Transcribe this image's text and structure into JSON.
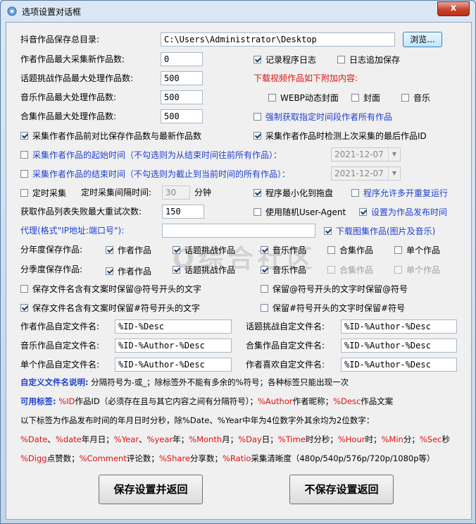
{
  "window": {
    "title": "选项设置对话框",
    "close_label": "x"
  },
  "main": {
    "save_dir_label": "抖音作品保存总目录:",
    "save_dir_value": "C:\\Users\\Administrator\\Desktop",
    "browse_label": "浏览...",
    "author_max_label": "作者作品最大采集新作品数:",
    "author_max_value": "0",
    "topic_max_label": "话题挑战作品最大处理作品数:",
    "topic_max_value": "500",
    "music_max_label": "音乐作品最大处理作品数:",
    "music_max_value": "500",
    "collection_max_label": "合集作品最大处理作品数:",
    "collection_max_value": "500",
    "log_label": "记录程序日志",
    "log_append_label": "日志追加保存",
    "download_extra_label": "下载视频作品如下附加内容:",
    "webp_label": "WEBP动态封面",
    "cover_label": "封面",
    "music_label": "音乐",
    "force_time_label": "强制获取指定时间段作者所有作品",
    "compare_label": "采集作者作品前对比保存作品数与最新作品数",
    "detect_last_label": "采集作者作品时检测上次采集的最后作品ID",
    "start_time_label": "采集作者作品的起始时间（不勾选则为从结束时间往前所有作品）：",
    "start_date": "2021-12-07",
    "end_time_label": "采集作者作品的结束时间（不勾选则为截止到当前时间的所有作品）：",
    "end_date": "2021-12-07",
    "timer_label": "定时采集",
    "timer_interval_label": "定时采集间隔时间:",
    "timer_value": "30",
    "timer_unit": "分钟",
    "min_tray_label": "程序最小化到拖盘",
    "multi_label": "程序允许多开重复运行",
    "retry_label": "获取作品列表失败最大重试次数:",
    "retry_value": "150",
    "random_ua_label": "使用随机User-Agent",
    "set_time_label": "设置为作品发布时间",
    "proxy_label": "代理(格式\"IP地址:端口号\"):",
    "proxy_value": "",
    "download_album_label": "下载图集作品(图片及音乐)",
    "year_save_label": "分年度保存作品:",
    "quarter_save_label": "分季度保存作品:",
    "author_works": "作者作品",
    "topic_works": "话题挑战作品",
    "music_works": "音乐作品",
    "collection_works": "合集作品",
    "single_works": "单个作品",
    "keep_at_label": "保存文件名含有文案时保留@符号开头的文字",
    "keep_at_symbol_label": "保留@符号开头的文字时保留@符号",
    "keep_hash_label": "保存文件名含有文案时保留#符号开头的文字",
    "keep_hash_symbol_label": "保留#符号开头的文字时保留#符号",
    "author_name_label": "作者作品自定文件名:",
    "author_name_value": "%ID-%Desc",
    "topic_name_label": "话题挑战自定文件名:",
    "topic_name_value": "%ID-%Author-%Desc",
    "music_name_label": "音乐作品自定文件名:",
    "music_name_value": "%ID-%Author-%Desc",
    "collection_name_label": "合集作品自定文件名:",
    "collection_name_value": "%ID-%Author-%Desc",
    "single_name_label": "单个作品自定文件名:",
    "single_name_value": "%ID-%Author-%Desc",
    "like_name_label": "作者喜欢自定文件名:",
    "like_name_value": "%ID-%Author-%Desc"
  },
  "help": {
    "title1": "自定义文件名说明:",
    "text1": "分隔符号为-或_；除标签外不能有多余的%符号；各种标签只能出现一次",
    "title2": "可用标签:",
    "tag_id": "%ID",
    "tag_id_desc": "作品ID（必须存在且与其它内容之间有分隔符号）；",
    "tag_author": "%Author",
    "tag_author_desc": "作者昵称；",
    "tag_desc": "%Desc",
    "tag_desc_desc": "作品文案",
    "line3": "以下标签为作品发布时间的年月日时分秒，除%Date、%Year中年为4位数字外其余均为2位数字：",
    "t_date": "%Date",
    "sep1": "、",
    "t_date2": "%date",
    "d_date": "年月日；",
    "t_year": "%Year",
    "sep2": "、",
    "t_year2": "%year",
    "d_year": "年；",
    "t_month": "%Month",
    "d_month": "月；",
    "t_day": "%Day",
    "d_day": "日；",
    "t_time": "%Time",
    "d_time": "时分秒；",
    "t_hour": "%Hour",
    "d_hour": "时；",
    "t_min": "%Min",
    "d_min": "分；",
    "t_sec": "%Sec",
    "d_sec": "秒",
    "t_digg": "%Digg",
    "d_digg": "点赞数；",
    "t_comment": "%Comment",
    "d_comment": "评论数；",
    "t_share": "%Share",
    "d_share": "分享数；",
    "t_ratio": "%Ratio",
    "d_ratio": "采集清晰度（480p/540p/576p/720p/1080p等）"
  },
  "buttons": {
    "save": "保存设置并返回",
    "nosave": "不保存设置返回"
  },
  "watermark": "Q综合社区"
}
